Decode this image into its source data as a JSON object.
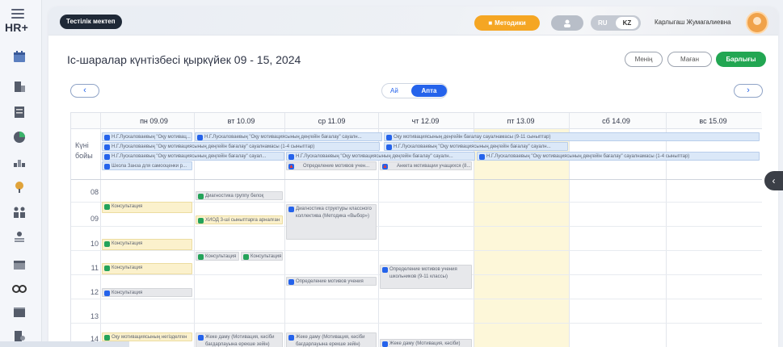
{
  "brand": "HR+",
  "sidebar": {
    "icons": [
      "calendar-icon",
      "building-icon",
      "document-icon",
      "pie-chart-icon",
      "structure-icon",
      "tree-icon",
      "people-icon",
      "person-list-icon",
      "table-icon",
      "binoculars-icon",
      "folder-icon",
      "building-settings-icon"
    ]
  },
  "topbar": {
    "school": "Тестілік мектеп",
    "methodics": "Методики",
    "lang_ru": "RU",
    "lang_kz": "KZ",
    "user_name": "Карлыгаш Жумагалиевна"
  },
  "page": {
    "title": "Іс-шаралар күнтізбесі қыркүйек 09 - 15, 2024"
  },
  "filters": {
    "mine": "Менің",
    "me": "Маған",
    "all": "Барлығы"
  },
  "nav": {
    "prev": "‹",
    "next": "›",
    "month": "Ай",
    "week": "Апта"
  },
  "calendar": {
    "days": [
      "пн 09.09",
      "вт 10.09",
      "ср 11.09",
      "чт 12.09",
      "пт 13.09",
      "сб 14.09",
      "вс 15.09"
    ],
    "allday_label": "Күні бойы",
    "hours": [
      "08",
      "09",
      "10",
      "11",
      "12",
      "13",
      "14"
    ],
    "allday_events": [
      "Н.Г.Лускаловаевың \"Оқу мотивац...",
      "Н.Г.Лускаловаевың \"Оқу мотивациясының деңгейін бағалау\" сауалн...",
      "Оқу мотивациясының деңгейін бағалау сауалнамасы (9-11 сыныптар)",
      "Н.Г.Лускаловаевың \"Оқу мотивациясының деңгейін бағалау\" сауалнамасы (1-4 сыныптар)",
      "Н.Г.Лускаловаевың \"Оқу мотивациясының деңгейін бағалау\" сауалн...",
      "Н.Г.Лускаловаевың \"Оқу мотивациясының деңгейін бағалау\" сауал...",
      "Н.Г.Лускаловаевың \"Оқу мотивациясының деңгейін бағалау\" сауалн...",
      "Н.Г.Лускаловаевың \"Оқу мотивациясының деңгейін бағалау\" сауалнамасы (1-4 сыныптар)",
      "Школа Занза для самооценки р...",
      "Определение мотивов учен...",
      "Анкета мотивации учащихся (8..."
    ],
    "timed_events": [
      "Консультация",
      "Диагностика группу белоқ",
      "Диагностика структуры классного коллектива (Методика «Выбор»)",
      "ХИОД 3-ші сыныптарға арналған",
      "Консультация",
      "Консультация",
      "Консультация",
      "Консультация",
      "Определение мотивов учения школьников (9-11 классы)",
      "Определение мотивов учения",
      "Консультация",
      "Оқу мотивациясының негізделген",
      "Жеке даму (Мотивация, кәсіби бағдарлауына ерекше зейін)",
      "Жеке даму (Мотивация, кәсіби бағдарлауына ерекше зейін)",
      "Жеке даму (Мотивация, кәсіби)"
    ]
  },
  "colors": {
    "accent": "#2563eb",
    "green": "#22a652",
    "orange": "#f5a623",
    "today": "#fdf7d9"
  }
}
